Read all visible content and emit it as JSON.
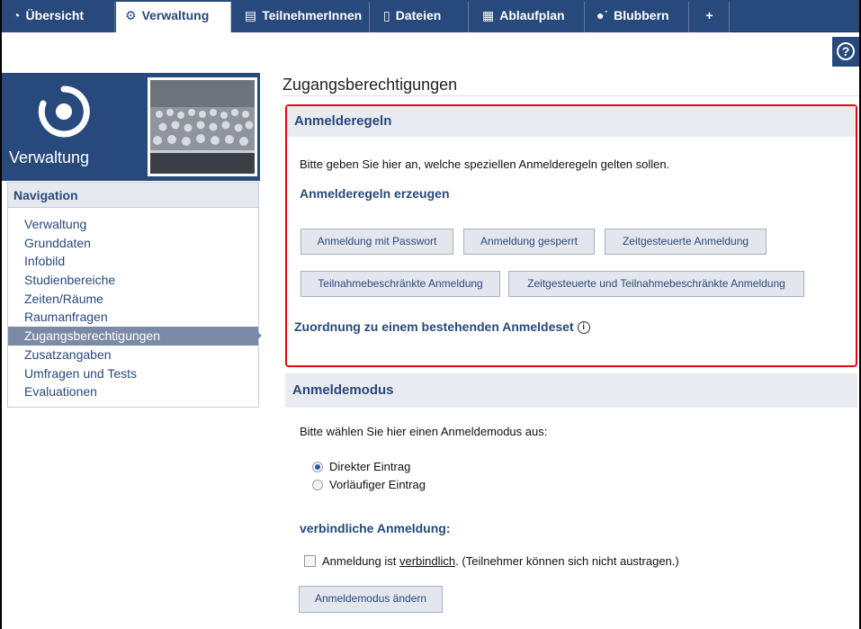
{
  "tabs": [
    {
      "label": "Übersicht",
      "icon": "overview-icon"
    },
    {
      "label": "Verwaltung",
      "icon": "gears-icon"
    },
    {
      "label": "TeilnehmerInnen",
      "icon": "participants-icon"
    },
    {
      "label": "Dateien",
      "icon": "files-icon"
    },
    {
      "label": "Ablaufplan",
      "icon": "calendar-icon"
    },
    {
      "label": "Blubbern",
      "icon": "blubber-icon"
    },
    {
      "label": "+",
      "icon": ""
    }
  ],
  "help_label": "?",
  "sidebar": {
    "title": "Verwaltung",
    "nav_heading": "Navigation",
    "items": [
      {
        "label": "Verwaltung"
      },
      {
        "label": "Grunddaten"
      },
      {
        "label": "Infobild"
      },
      {
        "label": "Studienbereiche"
      },
      {
        "label": "Zeiten/Räume"
      },
      {
        "label": "Raumanfragen"
      },
      {
        "label": "Zugangsberechtigungen",
        "active": true
      },
      {
        "label": "Zusatzangaben"
      },
      {
        "label": "Umfragen und Tests"
      },
      {
        "label": "Evaluationen"
      }
    ]
  },
  "main": {
    "title": "Zugangsberechtigungen",
    "rules": {
      "heading": "Anmelderegeln",
      "description": "Bitte geben Sie hier an, welche speziellen Anmelderegeln gelten sollen.",
      "create_heading": "Anmelderegeln erzeugen",
      "buttons": [
        "Anmeldung mit Passwort",
        "Anmeldung gesperrt",
        "Zeitgesteuerte Anmeldung",
        "Teilnahmebeschränkte Anmeldung",
        "Zeitgesteuerte und Teilnahmebeschränkte Anmeldung"
      ],
      "assign_heading": "Zuordnung zu einem bestehenden Anmeldeset"
    },
    "mode": {
      "heading": "Anmeldemodus",
      "description": "Bitte wählen Sie hier einen Anmeldemodus aus:",
      "options": [
        {
          "label": "Direkter Eintrag",
          "checked": true
        },
        {
          "label": "Vorläufiger Eintrag",
          "checked": false
        }
      ],
      "binding_heading": "verbindliche Anmeldung:",
      "binding_text_before": "Anmeldung ist ",
      "binding_link": "verbindlich",
      "binding_text_after": ". (Teilnehmer können sich nicht austragen.)",
      "submit_label": "Anmeldemodus ändern"
    }
  }
}
